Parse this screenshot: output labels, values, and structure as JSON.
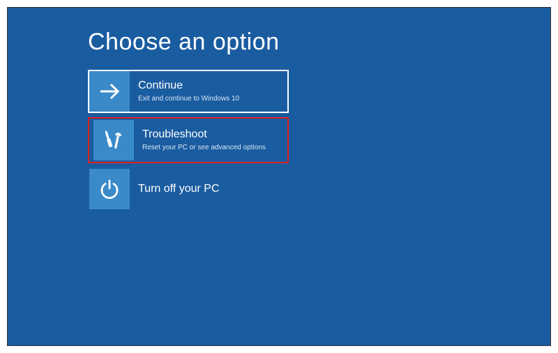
{
  "title": "Choose an option",
  "options": [
    {
      "icon": "arrow-right",
      "title": "Continue",
      "desc": "Exit and continue to Windows 10",
      "outlined": true
    },
    {
      "icon": "tools",
      "title": "Troubleshoot",
      "desc": "Reset your PC or see advanced options",
      "highlighted": true
    },
    {
      "icon": "power",
      "title": "Turn off your PC",
      "desc": ""
    }
  ],
  "colors": {
    "background": "#1a5ca0",
    "tile": "#3a8ac9",
    "highlight": "#e02020"
  }
}
